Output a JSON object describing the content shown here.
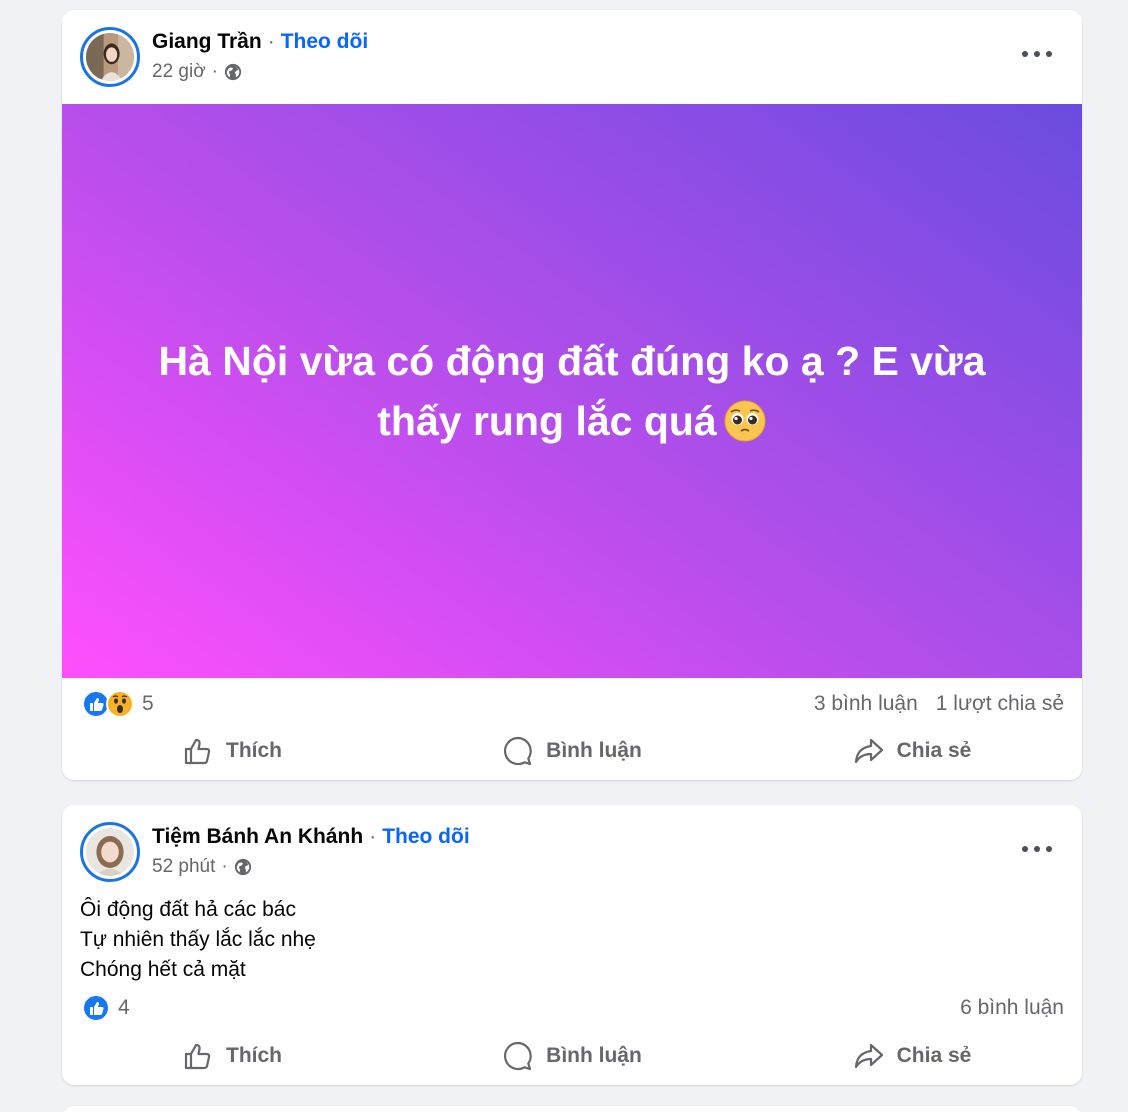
{
  "posts": [
    {
      "author": "Giang Trần",
      "follow": "Theo dõi",
      "time": "22 giờ",
      "content": "Hà Nội vừa có động đất đúng ko ạ ? E vừa thấy rung lắc quá",
      "reaction_count": "5",
      "comments": "3 bình luận",
      "shares": "1 lượt chia sẻ",
      "actions": {
        "like": "Thích",
        "comment": "Bình luận",
        "share": "Chia sẻ"
      }
    },
    {
      "author": "Tiệm Bánh An Khánh",
      "follow": "Theo dõi",
      "time": "52 phút",
      "lines": [
        "Ôi động đất hả các bác",
        "Tự nhiên thấy lắc lắc nhẹ",
        "Chóng hết cả mặt"
      ],
      "reaction_count": "4",
      "comments": "6 bình luận",
      "actions": {
        "like": "Thích",
        "comment": "Bình luận",
        "share": "Chia sẻ"
      }
    }
  ],
  "icons": {
    "like_reaction": "like-reaction-icon",
    "wow_reaction": "wow-reaction-icon",
    "globe": "globe-icon",
    "more": "more-options-icon",
    "emoji": "pleading-face-emoji"
  },
  "colors": {
    "accent": "#0866ff",
    "avatar_ring": "#1b74e4",
    "gradient_start": "#ff4ffd",
    "gradient_end": "#6a4ce0"
  }
}
